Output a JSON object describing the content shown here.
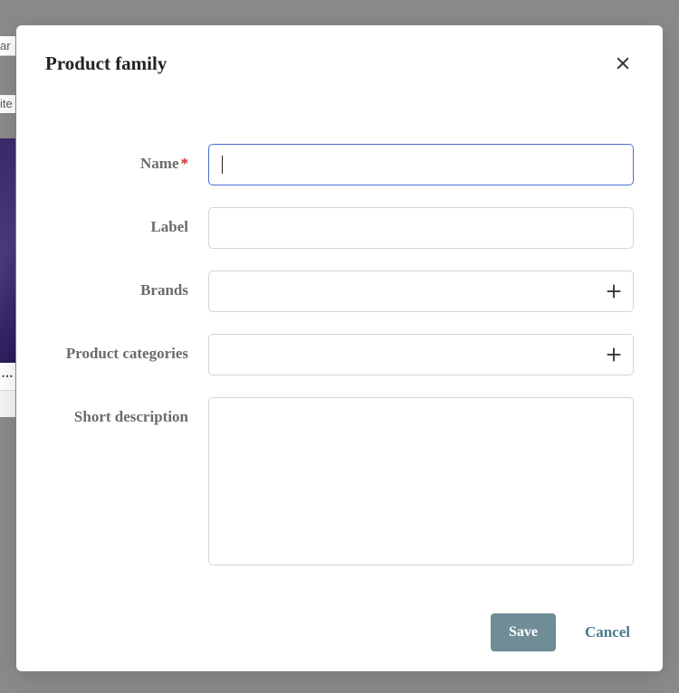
{
  "modal": {
    "title": "Product family",
    "fields": {
      "name": {
        "label": "Name",
        "required": true,
        "value": ""
      },
      "label": {
        "label": "Label",
        "value": ""
      },
      "brands": {
        "label": "Brands",
        "value": ""
      },
      "categories": {
        "label": "Product categories",
        "value": ""
      },
      "short_description": {
        "label": "Short description",
        "value": ""
      }
    },
    "buttons": {
      "save": "Save",
      "cancel": "Cancel"
    }
  },
  "background": {
    "frag1": "ar",
    "frag2": "ite",
    "frag3": "⋯"
  }
}
